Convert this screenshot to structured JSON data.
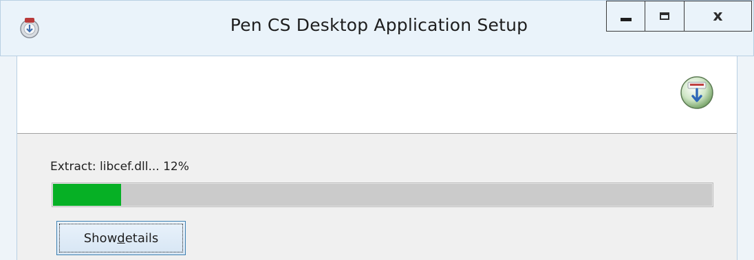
{
  "window": {
    "title": "Pen CS Desktop Application Setup",
    "icon": "installer-app-icon",
    "caption_buttons": {
      "minimize_icon": "minimize-icon",
      "maximize_icon": "maximize-icon",
      "close_glyph": "x"
    }
  },
  "header": {
    "icon": "install-download-icon"
  },
  "progress": {
    "status": "Extract: libcef.dll... 12%",
    "percent": 12,
    "fill_color": "#06b025"
  },
  "buttons": {
    "show_details": {
      "prefix": "Show ",
      "accel": "d",
      "suffix": "etails"
    }
  }
}
